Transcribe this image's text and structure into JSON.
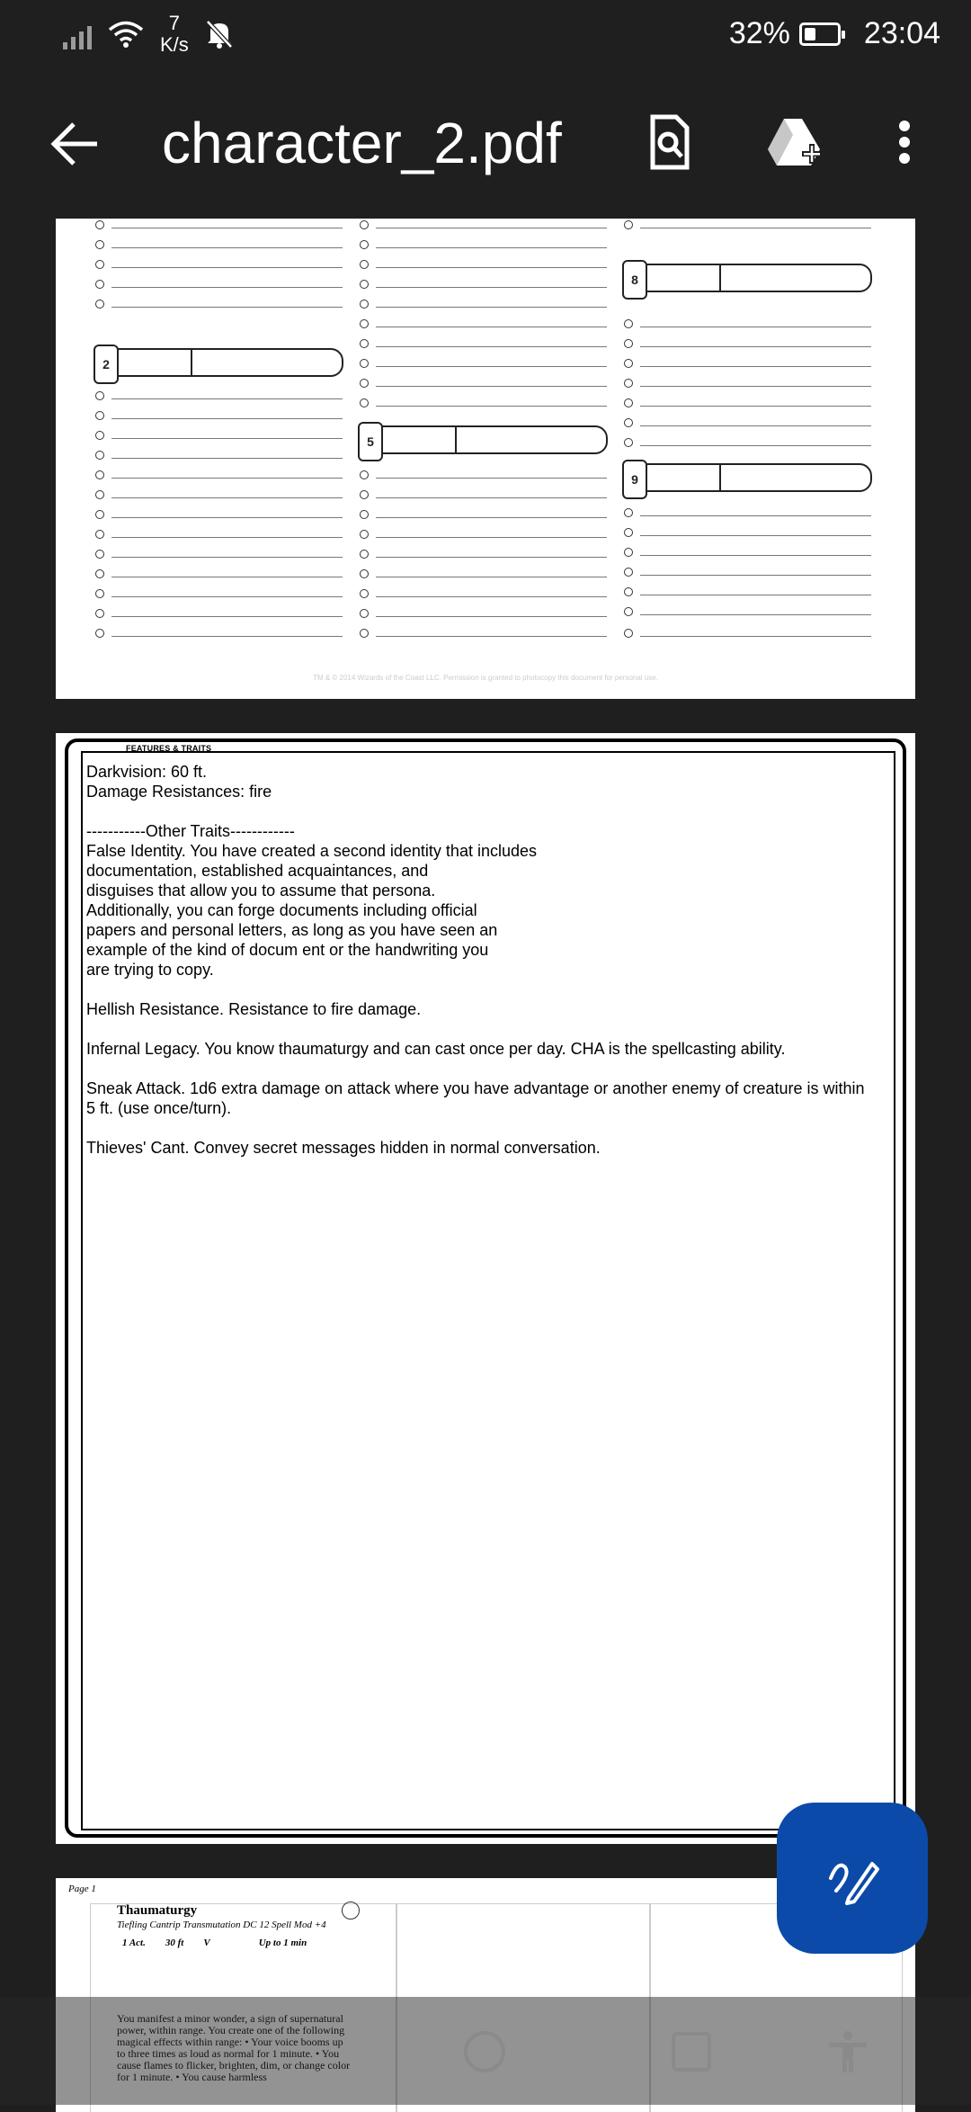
{
  "status_bar": {
    "net_speed_value": "7",
    "net_speed_unit": "K/s",
    "battery": "32%",
    "time": "23:04"
  },
  "app_bar": {
    "title": "character_2.pdf",
    "icons": [
      "back-arrow-icon",
      "find-in-document-icon",
      "add-to-drive-icon",
      "more-vert-icon"
    ]
  },
  "page1": {
    "spell_levels": [
      "2",
      "5",
      "8",
      "9"
    ],
    "copyright": "TM & © 2014 Wizards of the Coast LLC. Permission is granted to photocopy this document for personal use."
  },
  "page2": {
    "section_label": "FEATURES & TRAITS",
    "lines": [
      "Darkvision: 60 ft.",
      "Damage Resistances: fire",
      "",
      "-----------Other Traits------------",
      "False Identity. You have created a second identity that includes",
      "documentation, established acquaintances, and",
      "disguises that allow you to assume that persona.",
      "Additionally, you can forge documents including official",
      "papers and personal letters, as long as you have seen an",
      "example of the kind of docum ent or the handwriting you",
      "are trying to copy.",
      "",
      "Hellish Resistance. Resistance to fire damage.",
      "",
      "Infernal Legacy. You know thaumaturgy and can cast  once per day. CHA is the spellcasting ability.",
      "",
      "Sneak Attack. 1d6 extra damage on attack where you have advantage or another enemy of creature is within 5 ft. (use once/turn).",
      "",
      "Thieves' Cant. Convey secret messages hidden in normal conversation."
    ]
  },
  "page3": {
    "page_number": "Page 1",
    "spell": {
      "name": "Thaumaturgy",
      "subtitle": "Tiefling Cantrip Transmutation DC 12 Spell Mod +4",
      "casting_time": "1 Act.",
      "range": "30 ft",
      "components": "V",
      "duration": "Up to 1 min",
      "description": "You manifest a minor wonder, a sign of supernatural power, within range. You create one of the following magical effects within range: • Your voice booms up to three times as loud as normal for 1 minute. • You cause flames to flicker, brighten, dim, or change color for 1 minute. • You cause harmless"
    }
  },
  "fab": {
    "icon": "edit-pen-icon"
  },
  "nav_bar": {
    "icons": [
      "home-circle-icon",
      "recents-square-icon",
      "accessibility-icon"
    ]
  },
  "colors": {
    "background": "#1f1f1f",
    "fab": "#0b4aa8",
    "page": "#ffffff"
  }
}
